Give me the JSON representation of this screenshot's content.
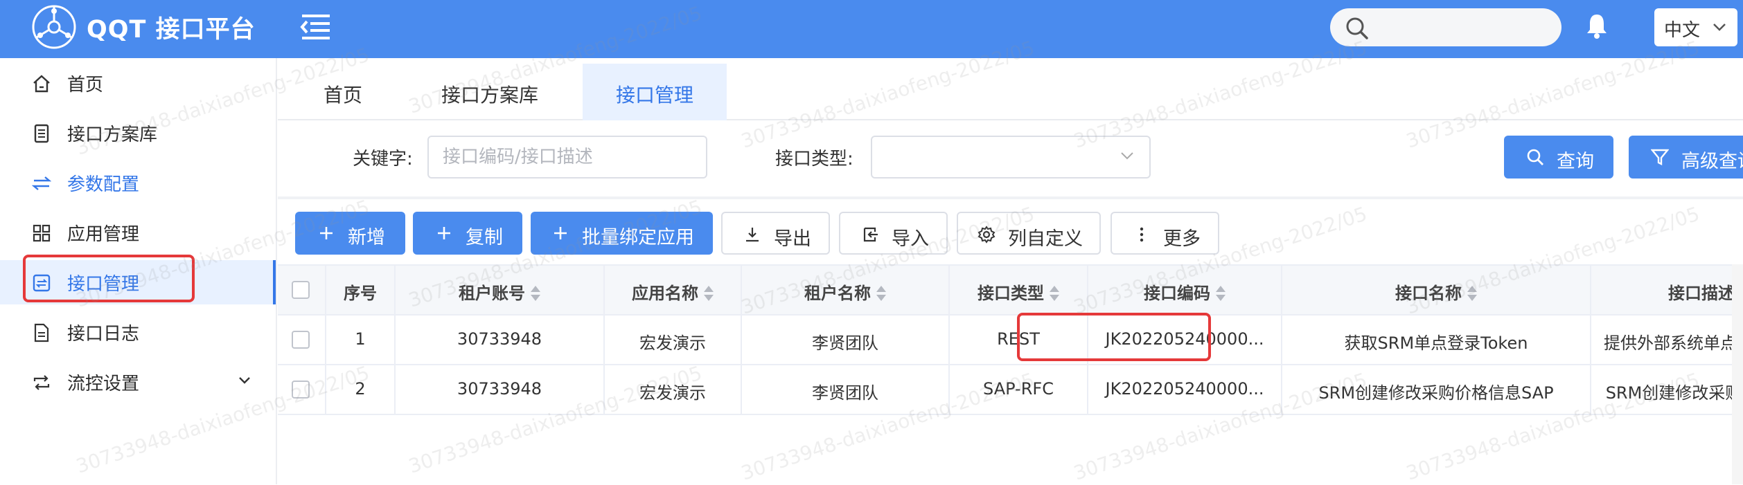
{
  "header": {
    "app_title": "QQT 接口平台",
    "search_placeholder": "",
    "language": "中文",
    "brand_color": "#4a8bee"
  },
  "sidebar": {
    "items": [
      {
        "label": "首页",
        "icon": "home-icon"
      },
      {
        "label": "接口方案库",
        "icon": "document-list-icon"
      },
      {
        "label": "参数配置",
        "icon": "swap-arrows-icon"
      },
      {
        "label": "应用管理",
        "icon": "grid-icon"
      },
      {
        "label": "接口管理",
        "icon": "interface-icon",
        "active": true
      },
      {
        "label": "接口日志",
        "icon": "log-file-icon"
      },
      {
        "label": "流控设置",
        "icon": "loop-icon",
        "expandable": true
      }
    ]
  },
  "tabs": [
    {
      "label": "首页"
    },
    {
      "label": "接口方案库"
    },
    {
      "label": "接口管理",
      "active": true
    }
  ],
  "filter": {
    "keyword_label": "关键字:",
    "keyword_placeholder": "接口编码/接口描述",
    "type_label": "接口类型:",
    "type_value": "",
    "query_button": "查询",
    "advanced_button": "高级查询"
  },
  "toolbar": {
    "add": "新增",
    "copy": "复制",
    "bind_apps": "批量绑定应用",
    "export": "导出",
    "import": "导入",
    "columns": "列自定义",
    "more": "更多"
  },
  "table": {
    "columns": [
      "序号",
      "租户账号",
      "应用名称",
      "租户名称",
      "接口类型",
      "接口编码",
      "接口名称",
      "接口描述"
    ],
    "rows": [
      [
        "1",
        "30733948",
        "宏发演示",
        "李贤团队",
        "REST",
        "JK202205240000...",
        "获取SRM单点登录Token",
        "提供外部系统单点登录到S"
      ],
      [
        "2",
        "30733948",
        "宏发演示",
        "李贤团队",
        "SAP-RFC",
        "JK202205240000...",
        "SRM创建修改采购价格信息SAP",
        "SRM创建修改采购价格信"
      ]
    ]
  },
  "watermark": "30733948-daixiaofeng-2022/05",
  "colors": {
    "primary": "#4a8bee",
    "active_text": "#3477e8",
    "active_bg": "#e8f1ff",
    "highlight_red": "#e5393a"
  }
}
